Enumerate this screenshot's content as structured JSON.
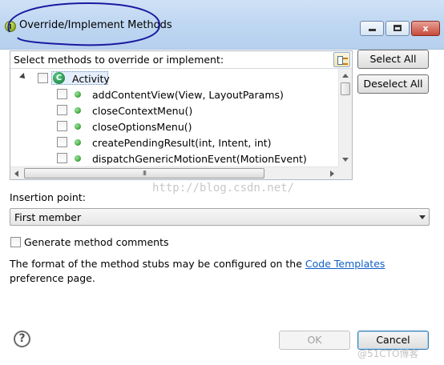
{
  "window": {
    "title": "Override/Implement Methods",
    "minimize_icon": "minimize-icon",
    "maximize_icon": "maximize-icon",
    "close_icon": "close-icon",
    "close_glyph": "x"
  },
  "prompt_label": "Select methods to override or implement:",
  "header_toggle_icon": "toggle-grouping-icon",
  "tree": {
    "class_node": {
      "icon_letter": "C",
      "label": "Activity"
    },
    "methods": [
      "addContentView(View, LayoutParams)",
      "closeContextMenu()",
      "closeOptionsMenu()",
      "createPendingResult(int, Intent, int)",
      "dispatchGenericMotionEvent(MotionEvent)"
    ],
    "scroll_thumb_grip": "III"
  },
  "buttons": {
    "select_all": "Select All",
    "deselect_all": "Deselect All",
    "ok": "OK",
    "cancel": "Cancel"
  },
  "insertion": {
    "label": "Insertion point:",
    "selected": "First member"
  },
  "generate_comments": {
    "label": "Generate method comments",
    "checked": false
  },
  "info": {
    "before_link": "The format of the method stubs may be configured on the ",
    "link": "Code Templates",
    "after_link": " preference page."
  },
  "help_glyph": "?",
  "watermarks": {
    "center": "http://blog.csdn.net/",
    "corner": "@51CTO博客"
  },
  "colors": {
    "titlebar": "#bcd5f1",
    "link": "#1060c8",
    "class_icon": "#1e8a45",
    "annotation_stroke": "#1a1aa0"
  }
}
